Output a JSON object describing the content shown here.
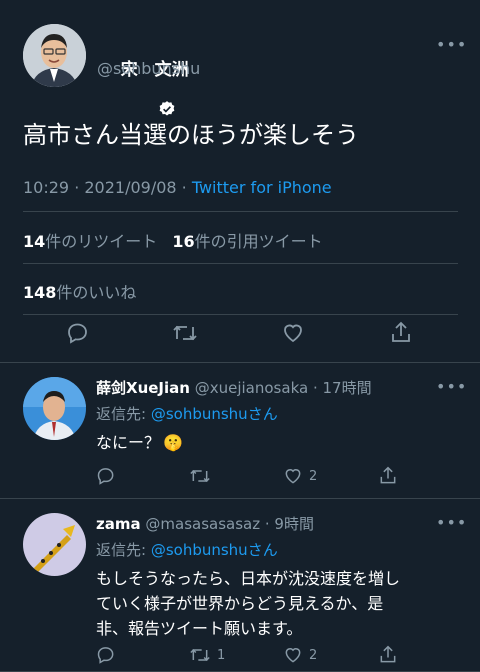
{
  "main": {
    "name": "宋　文洲",
    "handle": "@sohbunshu",
    "text": "高市さん当選のほうが楽しそう",
    "time": "10:29 · 2021/09/08 · ",
    "source": "Twitter for iPhone",
    "stats": {
      "retweets": "14",
      "retweets_label": "件のリツイート",
      "quotes": "16",
      "quotes_label": "件の引用ツイート",
      "likes": "148",
      "likes_label": "件のいいね"
    }
  },
  "replies": [
    {
      "name": "薛剑XueJian",
      "handle": "@xuejianosaka · 17時間",
      "reply_prefix": "返信先: ",
      "reply_user": "@sohbunshu",
      "reply_suffix": "さん",
      "text": "なにー？",
      "emoji": "🤫",
      "retweet_count": "",
      "like_count": "2"
    },
    {
      "name": "zama",
      "handle": "@masasasasaz · 9時間",
      "reply_prefix": "返信先: ",
      "reply_user": "@sohbunshu",
      "reply_suffix": "さん",
      "text_lines": [
        "もしそうなったら、日本が沈没速度を増し",
        "ていく様子が世界からどう見えるか、是",
        "非、報告ツイート願います。"
      ],
      "retweet_count": "1",
      "like_count": "2"
    }
  ],
  "icons": [
    "verified-badge-icon",
    "more-icon",
    "reply-icon",
    "retweet-icon",
    "like-icon",
    "share-icon"
  ],
  "colors": {
    "background": "#15202b",
    "accent": "#1d9bf0",
    "muted": "#8899a6",
    "border": "#38444d"
  }
}
